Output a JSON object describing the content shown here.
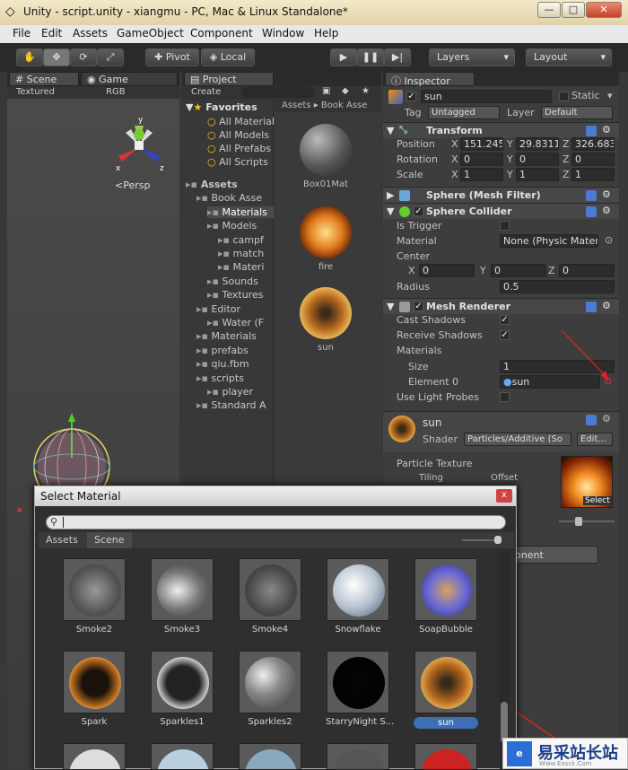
{
  "window": {
    "title": "Unity - script.unity - xiangmu - PC, Mac & Linux Standalone*",
    "controls": [
      "—",
      "□",
      "✕"
    ]
  },
  "menu": [
    "File",
    "Edit",
    "Assets",
    "GameObject",
    "Component",
    "Window",
    "Help"
  ],
  "toolbar": {
    "pivot": "Pivot",
    "local": "Local",
    "layers": "Layers",
    "layout": "Layout"
  },
  "scene": {
    "tab_scene": "Scene",
    "tab_game": "Game",
    "shading": "Textured",
    "channel": "RGB",
    "persp": "<Persp",
    "gizmo": {
      "x": "x",
      "y": "y",
      "z": "z"
    }
  },
  "project": {
    "tab": "Project",
    "create": "Create",
    "breadcrumb": "Assets ▸ Book Asse",
    "favorites": {
      "title": "Favorites",
      "items": [
        "All Material",
        "All Models",
        "All Prefabs",
        "All Scripts"
      ]
    },
    "tree": [
      {
        "label": "Assets",
        "level": 0,
        "bold": true
      },
      {
        "label": "Book Asse",
        "level": 1
      },
      {
        "label": "Materials",
        "level": 2,
        "selected": true
      },
      {
        "label": "Models",
        "level": 2
      },
      {
        "label": "campf",
        "level": 3
      },
      {
        "label": "match",
        "level": 3
      },
      {
        "label": "Materi",
        "level": 3
      },
      {
        "label": "Sounds",
        "level": 2
      },
      {
        "label": "Textures",
        "level": 2
      },
      {
        "label": "Editor",
        "level": 1
      },
      {
        "label": "Water (F",
        "level": 2
      },
      {
        "label": "Materials",
        "level": 1
      },
      {
        "label": "prefabs",
        "level": 1
      },
      {
        "label": "qiu.fbm",
        "level": 1
      },
      {
        "label": "scripts",
        "level": 1
      },
      {
        "label": "player",
        "level": 2
      },
      {
        "label": "Standard A",
        "level": 1
      }
    ],
    "assets": [
      "Box01Mat",
      "fire",
      "sun"
    ]
  },
  "inspector": {
    "tab": "Inspector",
    "object_name": "sun",
    "static_label": "Static",
    "tag_label": "Tag",
    "tag_value": "Untagged",
    "layer_label": "Layer",
    "layer_value": "Default",
    "transform": {
      "title": "Transform",
      "position": {
        "label": "Position",
        "x": "151.245",
        "y": "29.8311",
        "z": "326.683"
      },
      "rotation": {
        "label": "Rotation",
        "x": "0",
        "y": "0",
        "z": "0"
      },
      "scale": {
        "label": "Scale",
        "x": "1",
        "y": "1",
        "z": "1"
      }
    },
    "mesh_filter": {
      "title": "Sphere (Mesh Filter)"
    },
    "collider": {
      "title": "Sphere Collider",
      "is_trigger": "Is Trigger",
      "material_label": "Material",
      "material_value": "None (Physic Materi",
      "center_label": "Center",
      "cx": "0",
      "cy": "0",
      "cz": "0",
      "radius_label": "Radius",
      "radius_value": "0.5"
    },
    "renderer": {
      "title": "Mesh Renderer",
      "cast": "Cast Shadows",
      "receive": "Receive Shadows",
      "materials": "Materials",
      "size_label": "Size",
      "size_value": "1",
      "element_label": "Element 0",
      "element_value": "sun",
      "light_probes": "Use Light Probes"
    },
    "material": {
      "name": "sun",
      "shader_label": "Shader",
      "shader_value": "Particles/Additive (So",
      "edit": "Edit...",
      "particle_texture": "Particle Texture",
      "tiling": "Tiling",
      "offset": "Offset",
      "select": "Select"
    },
    "add_component": "onent"
  },
  "select_material": {
    "title": "Select Material",
    "close": "x",
    "tab_assets": "Assets",
    "tab_scene": "Scene",
    "items": [
      {
        "name": "Smoke2",
        "style": "smoke"
      },
      {
        "name": "Smoke3",
        "style": "smoke3"
      },
      {
        "name": "Smoke4",
        "style": "smoke4"
      },
      {
        "name": "Snowflake",
        "style": "snow"
      },
      {
        "name": "SoapBubble",
        "style": "bubble"
      },
      {
        "name": "Spark",
        "style": "spark"
      },
      {
        "name": "Sparkles1",
        "style": "sparkles"
      },
      {
        "name": "Sparkles2",
        "style": "sparkles2"
      },
      {
        "name": "StarryNight S...",
        "style": "night"
      },
      {
        "name": "sun",
        "style": "sun",
        "selected": true
      }
    ]
  },
  "watermark": {
    "text": "易采站长站",
    "sub": "Www.Easck.Com"
  }
}
